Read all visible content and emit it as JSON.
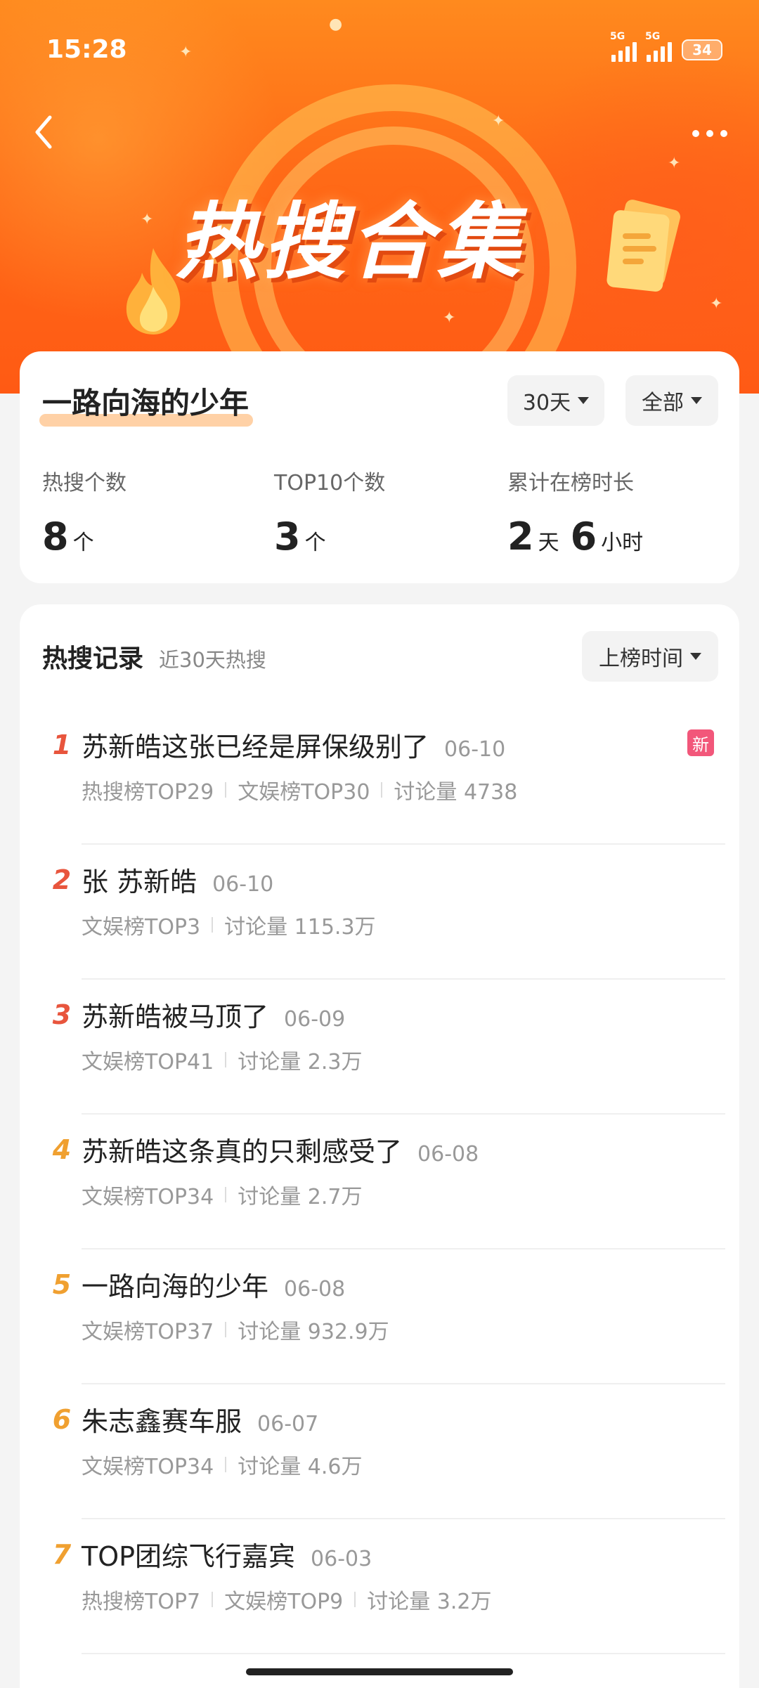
{
  "status_bar": {
    "time": "15:28",
    "net1": "5G",
    "net2": "5G",
    "battery": "34"
  },
  "header": {
    "banner_title": "热搜合集"
  },
  "summary": {
    "topic": "一路向海的少年",
    "filter_days": "30天",
    "filter_scope": "全部",
    "stats": [
      {
        "label": "热搜个数",
        "value": "8",
        "unit": "个"
      },
      {
        "label": "TOP10个数",
        "value": "3",
        "unit": "个"
      },
      {
        "label": "累计在榜时长",
        "value_days": "2",
        "unit_days": "天",
        "value_hours": "6",
        "unit_hours": "小时"
      }
    ]
  },
  "records": {
    "title": "热搜记录",
    "subtitle": "近30天热搜",
    "sort_label": "上榜时间",
    "new_badge": "新",
    "items": [
      {
        "rank": "1",
        "title": "苏新皓这张已经是屏保级别了",
        "date": "06-10",
        "meta": [
          "热搜榜TOP29",
          "文娱榜TOP30",
          "讨论量 4738"
        ],
        "rank_color": "#e8553d"
      },
      {
        "rank": "2",
        "title": "张   苏新皓",
        "date": "06-10",
        "meta": [
          "文娱榜TOP3",
          "讨论量 115.3万"
        ],
        "rank_color": "#e8553d"
      },
      {
        "rank": "3",
        "title": "苏新皓被马顶了",
        "date": "06-09",
        "meta": [
          "文娱榜TOP41",
          "讨论量 2.3万"
        ],
        "rank_color": "#e8553d"
      },
      {
        "rank": "4",
        "title": "苏新皓这条真的只剩感受了",
        "date": "06-08",
        "meta": [
          "文娱榜TOP34",
          "讨论量 2.7万"
        ],
        "rank_color": "#f0a030"
      },
      {
        "rank": "5",
        "title": "一路向海的少年",
        "date": "06-08",
        "meta": [
          "文娱榜TOP37",
          "讨论量 932.9万"
        ],
        "rank_color": "#f0a030"
      },
      {
        "rank": "6",
        "title": "朱志鑫赛车服",
        "date": "06-07",
        "meta": [
          "文娱榜TOP34",
          "讨论量 4.6万"
        ],
        "rank_color": "#f0a030"
      },
      {
        "rank": "7",
        "title": "TOP团综飞行嘉宾",
        "date": "06-03",
        "meta": [
          "热搜榜TOP7",
          "文娱榜TOP9",
          "讨论量 3.2万"
        ],
        "rank_color": "#f0a030"
      }
    ]
  }
}
